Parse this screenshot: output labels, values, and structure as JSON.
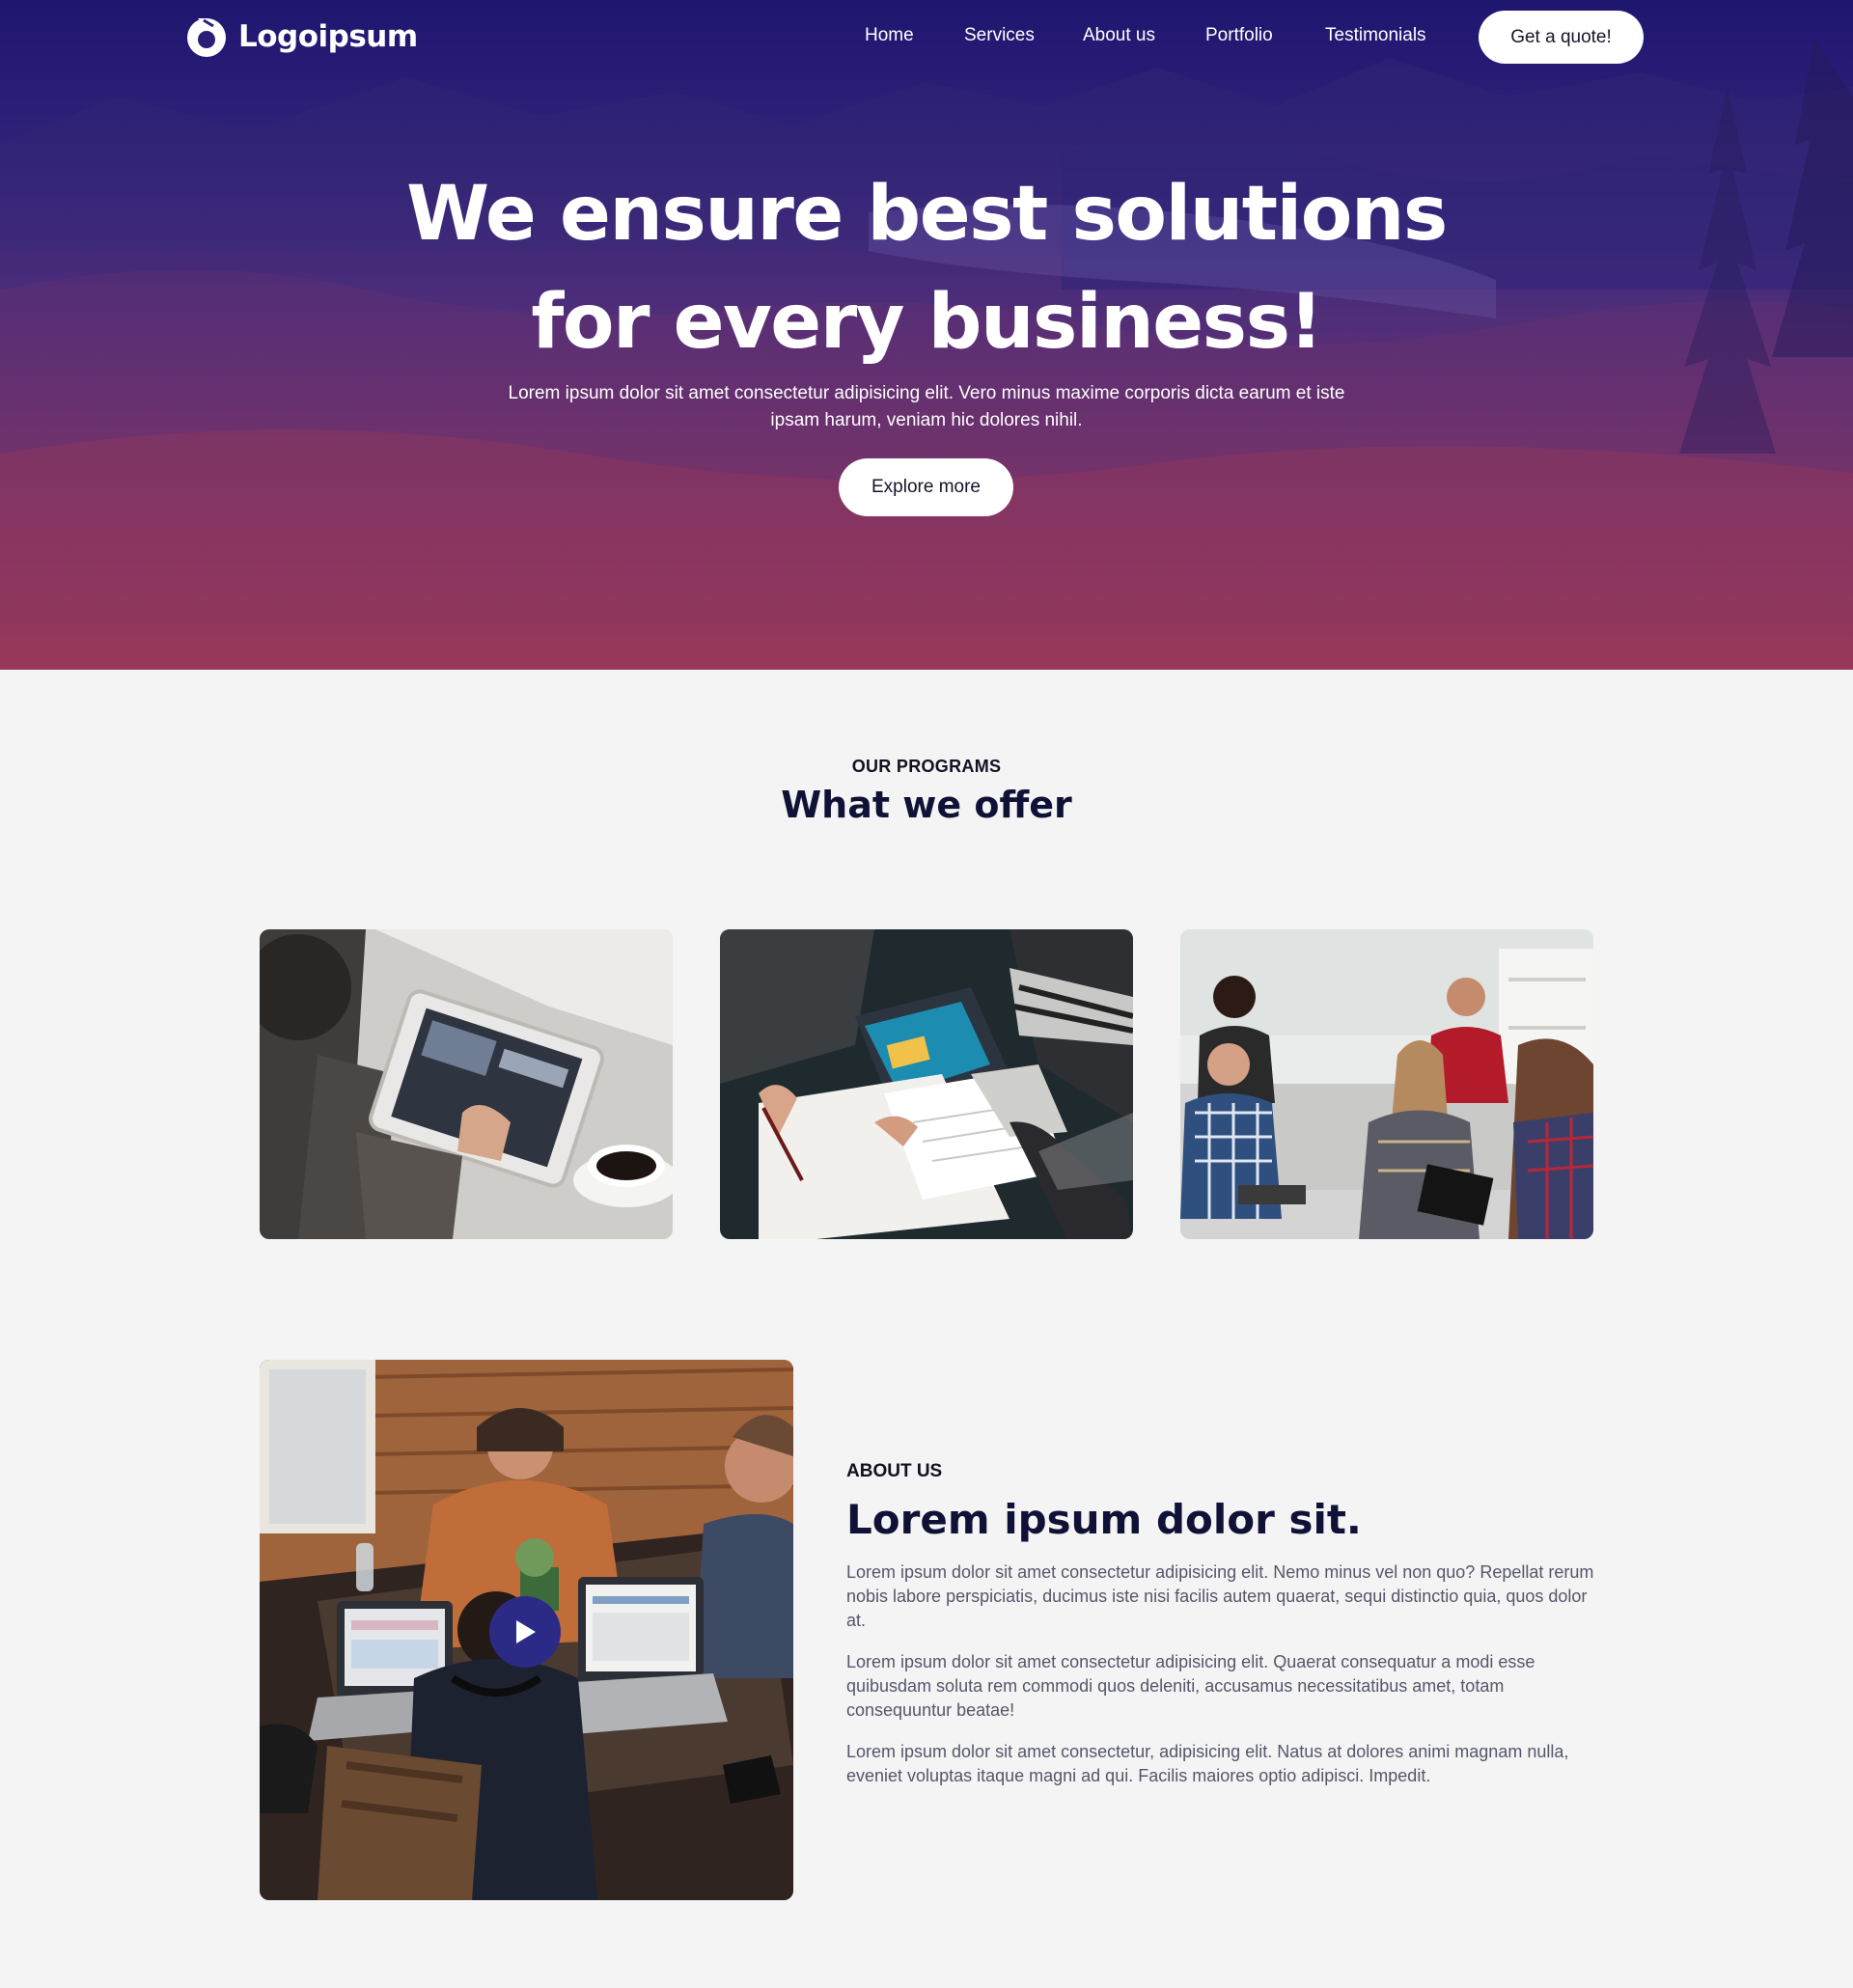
{
  "brand": {
    "logo_text": "Logoipsum"
  },
  "nav": {
    "items": [
      {
        "label": "Home"
      },
      {
        "label": "Services"
      },
      {
        "label": "About us"
      },
      {
        "label": "Portfolio"
      },
      {
        "label": "Testimonials"
      }
    ],
    "cta_label": "Get a quote!"
  },
  "hero": {
    "title_line1": "We ensure best solutions",
    "title_line2": "for every business!",
    "subtitle": "Lorem ipsum dolor sit amet consectetur adipisicing elit. Vero minus maxime corporis dicta earum et iste ipsam harum, veniam hic dolores nihil.",
    "button_label": "Explore more"
  },
  "programs": {
    "eyebrow": "OUR PROGRAMS",
    "title": "What we offer"
  },
  "about": {
    "eyebrow": "ABOUT US",
    "title": "Lorem ipsum dolor sit.",
    "paragraphs": [
      "Lorem ipsum dolor sit amet consectetur adipisicing elit. Nemo minus vel non quo? Repellat rerum nobis labore perspiciatis, ducimus iste nisi facilis autem quaerat, sequi distinctio quia, quos dolor at.",
      "Lorem ipsum dolor sit amet consectetur adipisicing elit. Quaerat consequatur a modi esse quibusdam soluta rem commodi quos deleniti, accusamus necessitatibus amet, totam consequuntur beatae!",
      "Lorem ipsum dolor sit amet consectetur, adipisicing elit. Natus at dolores animi magnam nulla, eveniet voluptas itaque magni ad qui. Facilis maiores optio adipisci. Impedit."
    ]
  },
  "colors": {
    "hero_top": "#1f1670",
    "hero_bottom": "#a53d57",
    "heading_navy": "#0f1236",
    "play_button": "#2b2a86",
    "page_bg": "#f4f4f4"
  }
}
